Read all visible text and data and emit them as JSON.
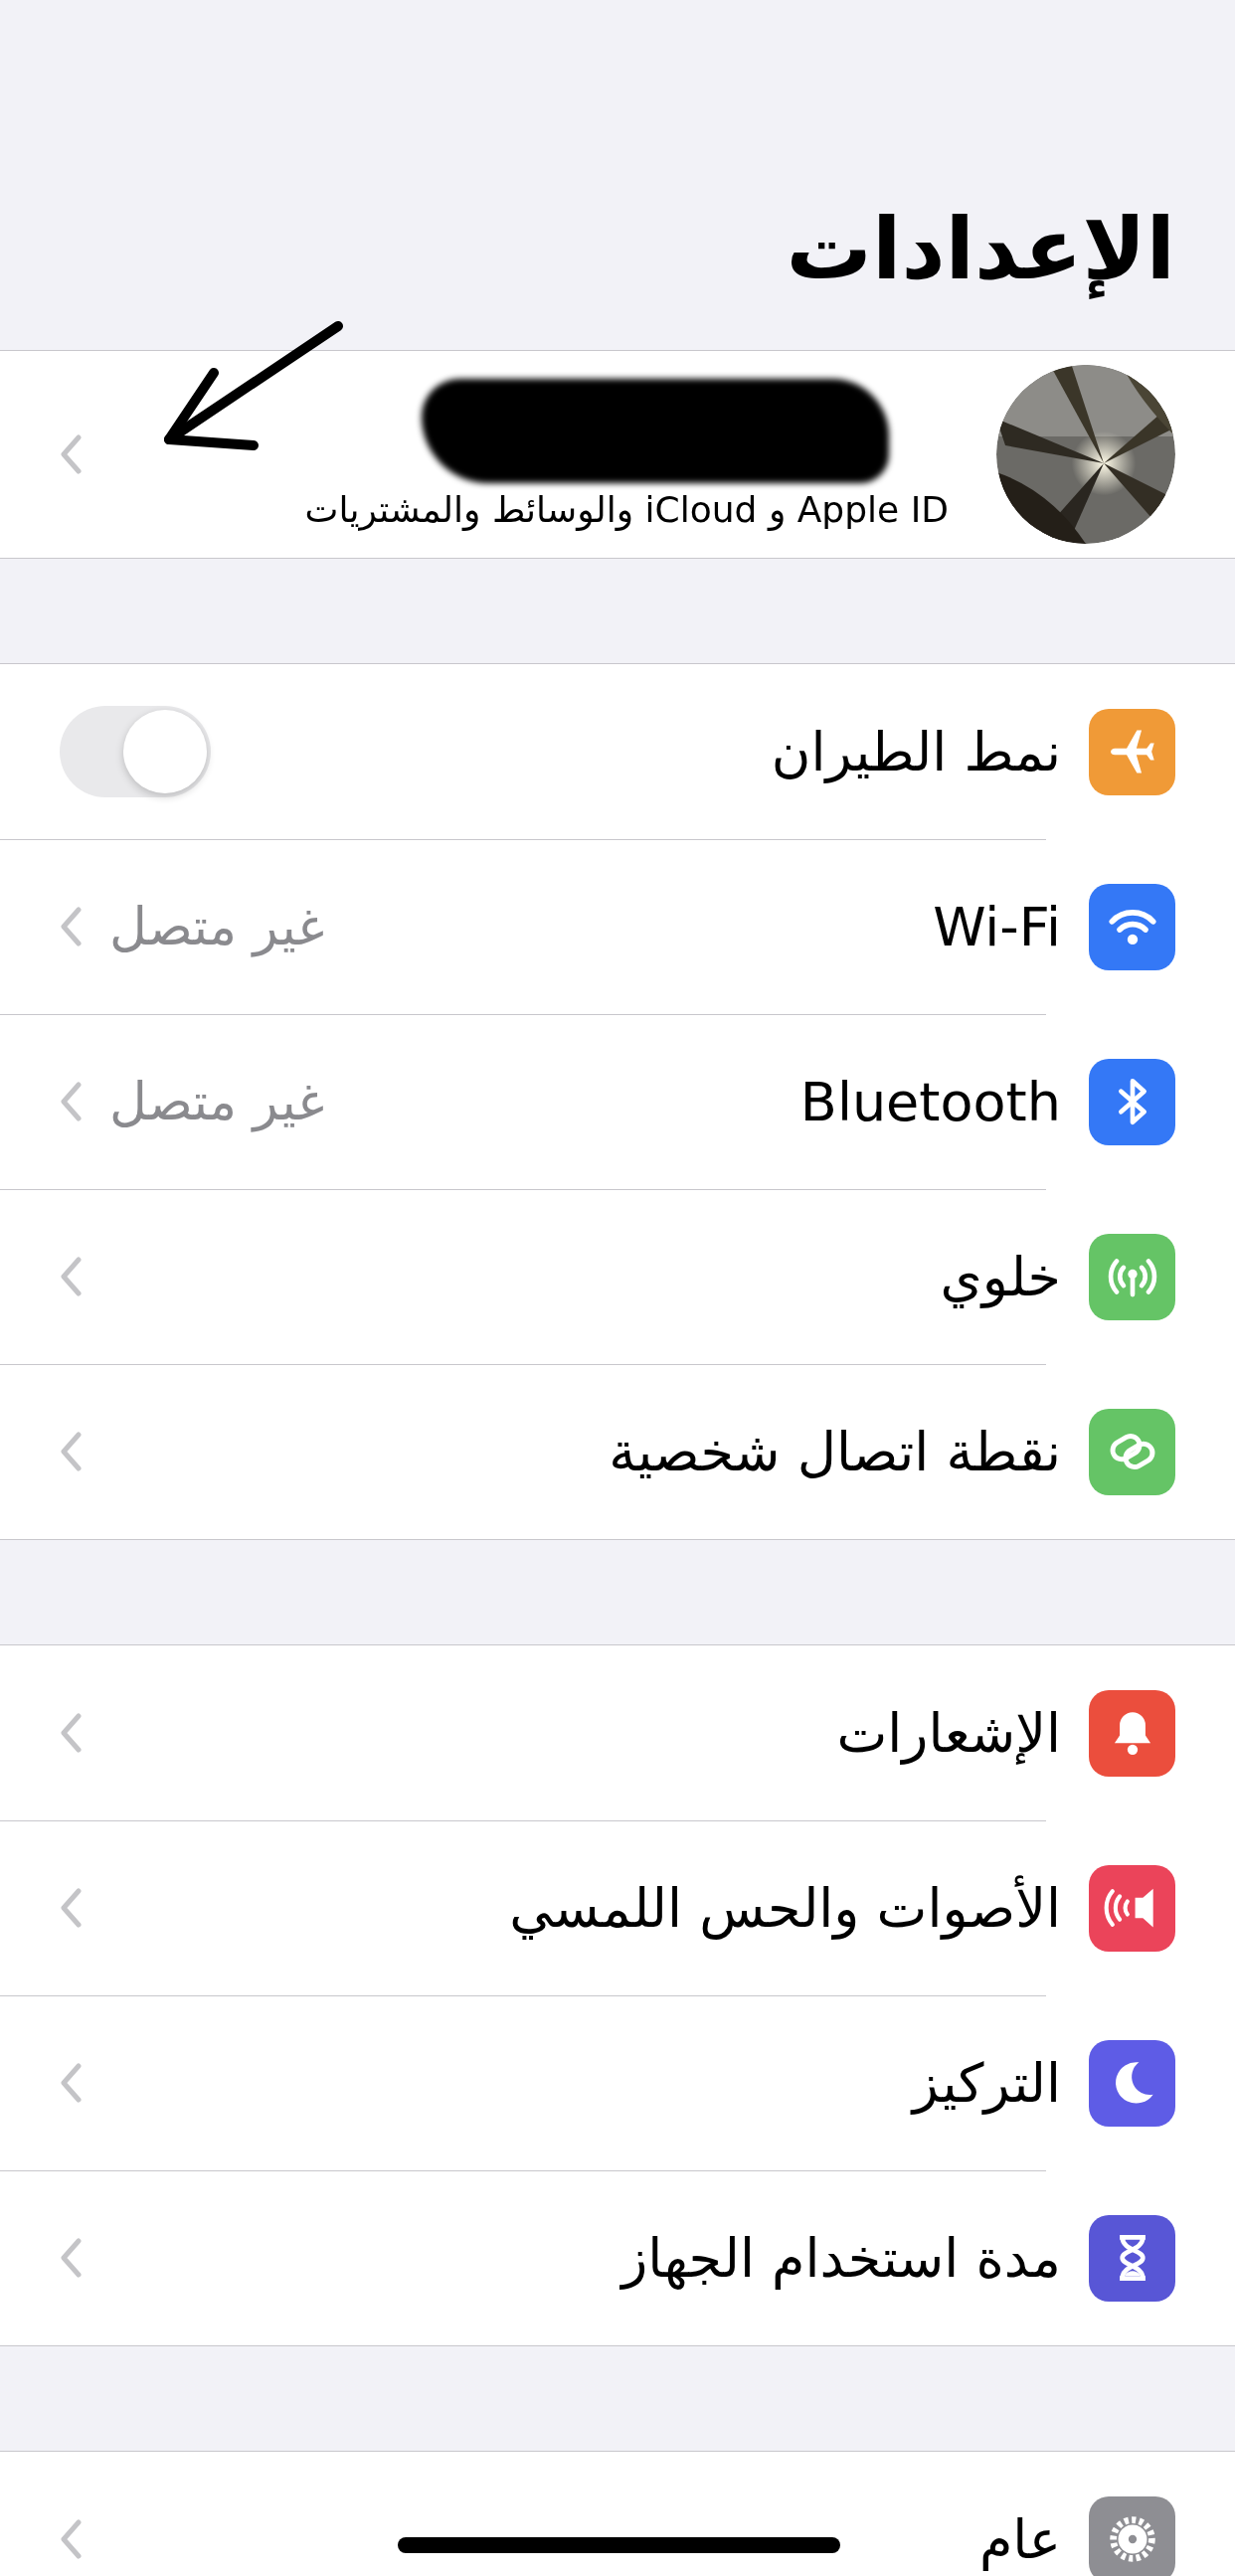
{
  "title": "الإعدادات",
  "profile": {
    "subtitle": "Apple ID و iCloud والوسائط والمشتريات"
  },
  "groups": [
    {
      "rows": [
        {
          "kind": "toggle",
          "color": "#f09a37",
          "label": "نمط الطيران",
          "on": false
        },
        {
          "kind": "link",
          "color": "#3478f6",
          "label": "Wi-Fi",
          "value": "غير متصل"
        },
        {
          "kind": "link",
          "color": "#3478f6",
          "label": "Bluetooth",
          "value": "غير متصل"
        },
        {
          "kind": "link",
          "color": "#65c466",
          "label": "خلوي"
        },
        {
          "kind": "link",
          "color": "#65c466",
          "label": "نقطة اتصال شخصية"
        }
      ]
    },
    {
      "rows": [
        {
          "kind": "link",
          "color": "#eb4e3d",
          "label": "الإشعارات"
        },
        {
          "kind": "link",
          "color": "#eb445a",
          "label": "الأصوات والحس اللمسي"
        },
        {
          "kind": "link",
          "color": "#5e5ce6",
          "label": "التركيز"
        },
        {
          "kind": "link",
          "color": "#5856d6",
          "label": "مدة استخدام الجهاز"
        }
      ]
    },
    {
      "rows": [
        {
          "kind": "link",
          "color": "#8e8e93",
          "label": "عام"
        }
      ]
    }
  ]
}
